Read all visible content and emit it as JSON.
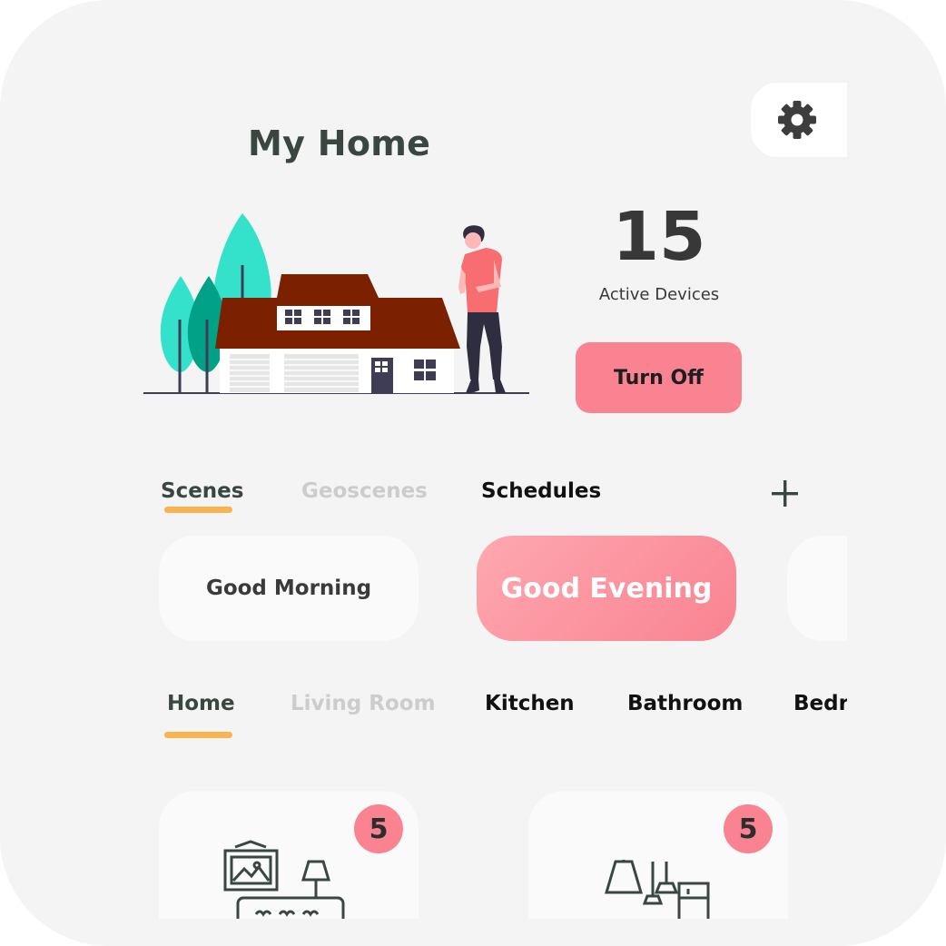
{
  "header": {
    "title": "My Home",
    "settings_icon": "gear-icon"
  },
  "summary": {
    "active_count": "15",
    "active_label": "Active Devices",
    "turn_off_label": "Turn Off"
  },
  "scene_tabs": [
    {
      "label": "Scenes",
      "selected": true
    },
    {
      "label": "Geoscenes",
      "selected": false
    },
    {
      "label": "Schedules",
      "selected": false
    }
  ],
  "add_icon": "plus-icon",
  "scenes": [
    {
      "label": "Good Morning",
      "active": false
    },
    {
      "label": "Good Evening",
      "active": true
    },
    {
      "label": "",
      "active": false
    }
  ],
  "room_tabs": [
    {
      "label": "Home",
      "selected": true
    },
    {
      "label": "Living Room",
      "selected": false
    },
    {
      "label": "Kitchen",
      "selected": false
    },
    {
      "label": "Bathroom",
      "selected": false
    },
    {
      "label": "Bedroom",
      "selected": false
    }
  ],
  "rooms": [
    {
      "icon": "living-room-icon",
      "device_count": "5"
    },
    {
      "icon": "kitchen-icon",
      "device_count": "5"
    }
  ],
  "colors": {
    "accent_pink": "#f98391",
    "underline": "#f7b34f",
    "title": "#3a4740",
    "background": "#f4f4f4"
  }
}
